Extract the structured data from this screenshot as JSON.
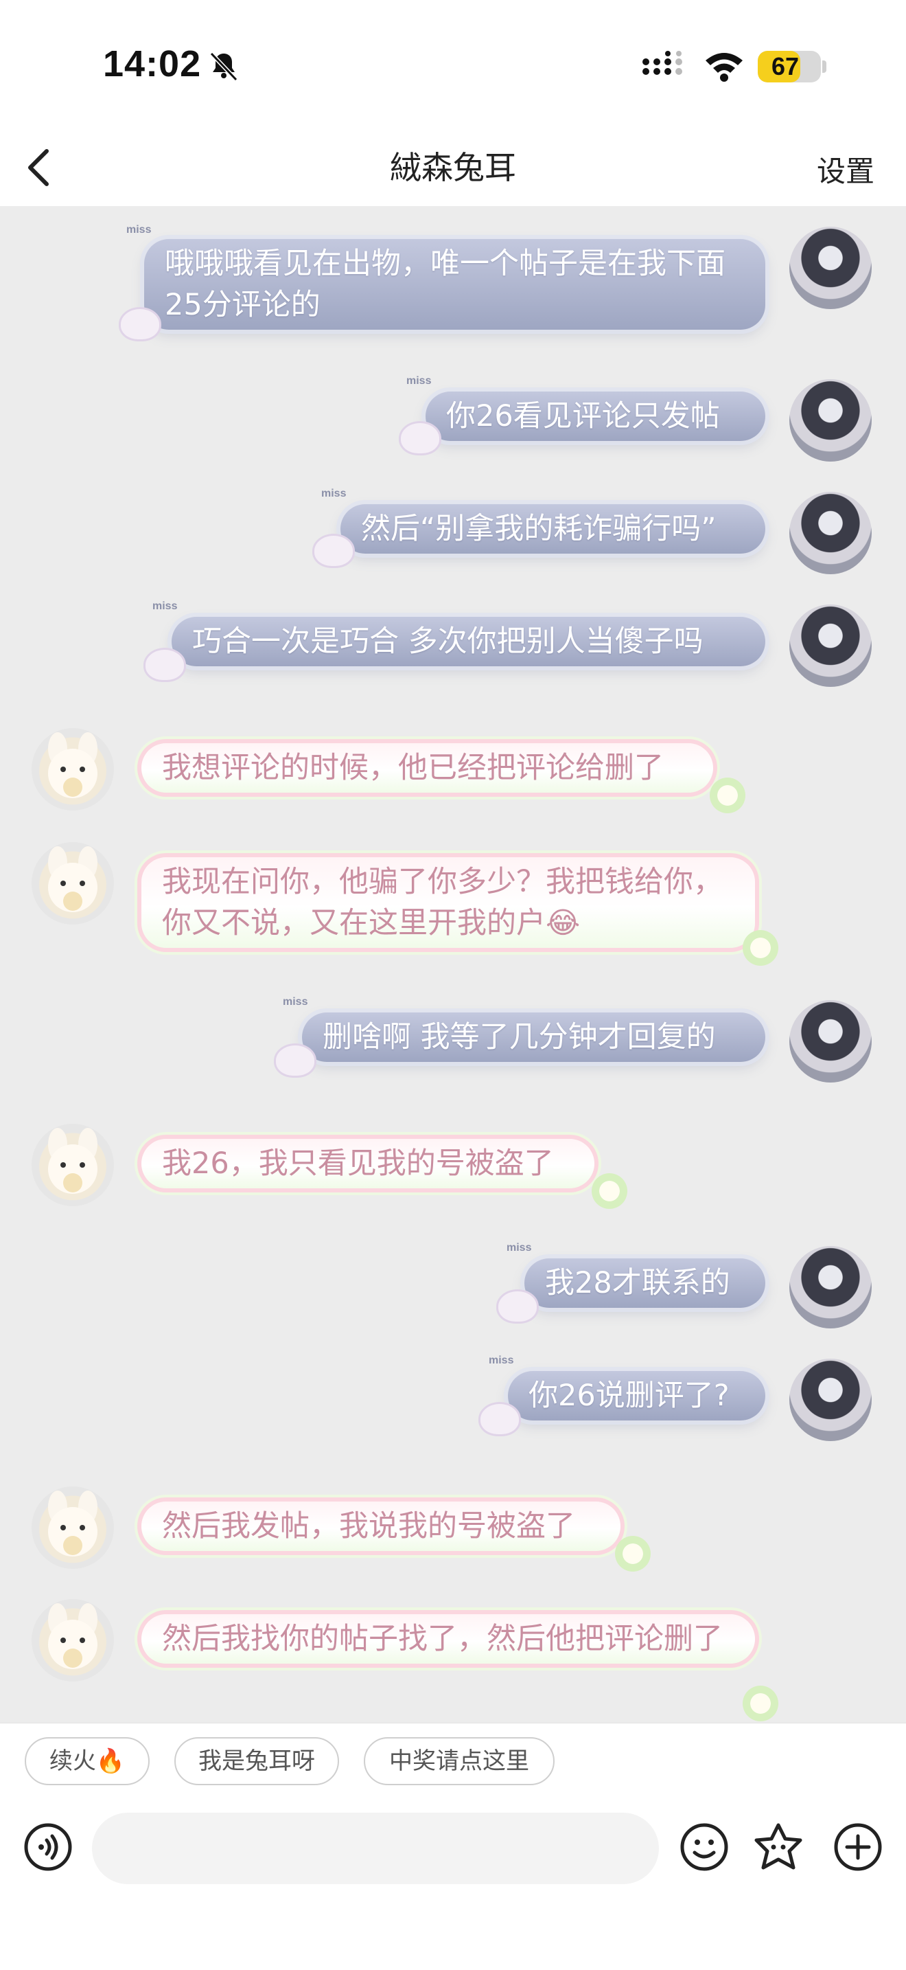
{
  "status": {
    "time": "14:02",
    "battery": "67",
    "battery_level": 0.67,
    "icons": [
      "bell-muted-icon",
      "signal-icon",
      "wifi-icon",
      "battery-icon"
    ]
  },
  "header": {
    "title": "絨森兔耳",
    "settings_label": "设置",
    "back_icon": "chevron-left-icon"
  },
  "messages": [
    {
      "side": "self",
      "text": "哦哦哦看见在出物，唯一个帖子是在我下面25分评论的"
    },
    {
      "side": "self",
      "text": "你26看见评论只发帖"
    },
    {
      "side": "self",
      "text": "然后“别拿我的耗诈骗行吗”"
    },
    {
      "side": "self",
      "text": "巧合一次是巧合 多次你把别人当傻子吗"
    },
    {
      "side": "other",
      "text": "我想评论的时候，他已经把评论给删了"
    },
    {
      "side": "other",
      "text": "我现在问你，他骗了你多少？我把钱给你，你又不说，又在这里开我的户😂"
    },
    {
      "side": "self",
      "text": "删啥啊 我等了几分钟才回复的"
    },
    {
      "side": "other",
      "text": "我26，我只看见我的号被盗了"
    },
    {
      "side": "self",
      "text": "我28才联系的"
    },
    {
      "side": "self",
      "text": "你26说删评了?"
    },
    {
      "side": "other",
      "text": "然后我发帖，我说我的号被盗了"
    },
    {
      "side": "other",
      "text": "然后我找你的帖子找了，然后他把评论删了"
    }
  ],
  "bubble_tag": "miss",
  "quick_replies": [
    {
      "label": "续火🔥"
    },
    {
      "label": "我是兔耳呀"
    },
    {
      "label": "中奖请点这里"
    }
  ],
  "input": {
    "placeholder": "",
    "icons": [
      "voice-icon",
      "emoji-icon",
      "sticker-icon",
      "plus-icon"
    ]
  },
  "colors": {
    "self_bubble": "#a9b0cc",
    "other_bubble_text": "#c98ea0",
    "battery": "#f5cf1d"
  }
}
